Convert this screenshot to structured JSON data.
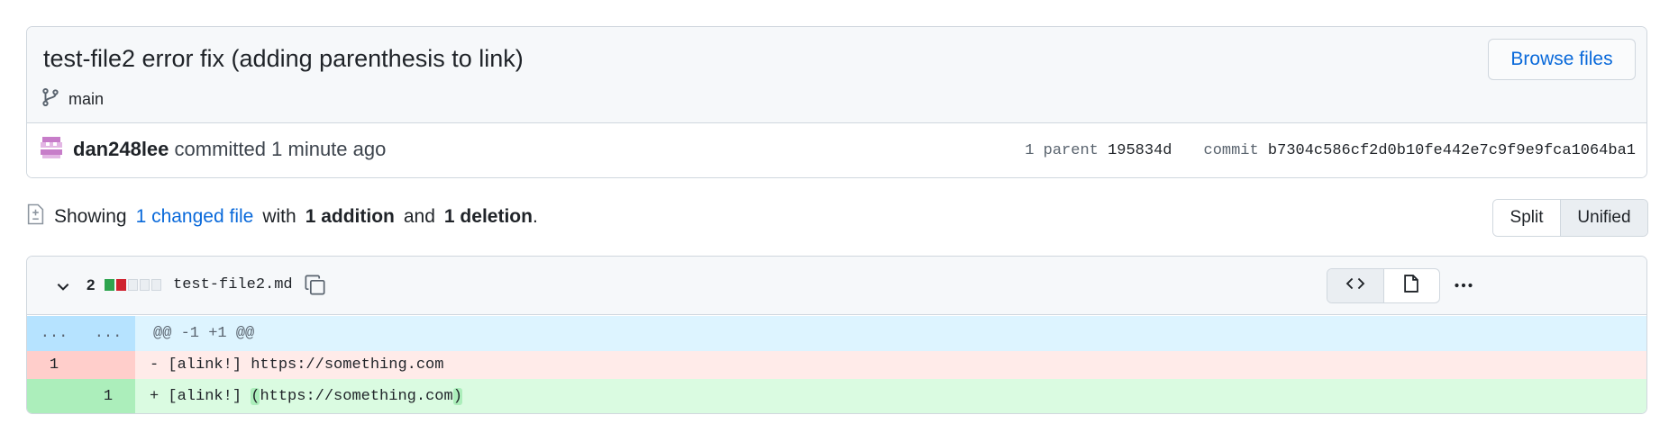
{
  "commit": {
    "title": "test-file2 error fix (adding parenthesis to link)",
    "branch": "main",
    "browse_button": "Browse files",
    "author": "dan248lee",
    "action": "committed",
    "time": "1 minute ago",
    "parent_label": "1 parent",
    "parent_sha": "195834d",
    "commit_label": "commit",
    "commit_sha": "b7304c586cf2d0b10fe442e7c9f9e9fca1064ba1"
  },
  "summary": {
    "showing": "Showing",
    "changed_files": "1 changed file",
    "with": "with",
    "additions": "1 addition",
    "and": "and",
    "deletions": "1 deletion",
    "period": "."
  },
  "view_toggle": {
    "split": "Split",
    "unified": "Unified",
    "selected": "Unified"
  },
  "file": {
    "change_count": "2",
    "diffstat": [
      "added",
      "deleted",
      "neutral",
      "neutral",
      "neutral"
    ],
    "name": "test-file2.md",
    "hunk": {
      "old_marker": "...",
      "new_marker": "...",
      "header": "@@ -1 +1 @@"
    },
    "deleted_line": {
      "old_num": "1",
      "new_num": "",
      "prefix": "-",
      "text": "[alink!] https://something.com"
    },
    "added_line": {
      "old_num": "",
      "new_num": "1",
      "prefix": "+",
      "text_before": "[alink!] ",
      "text_open": "(",
      "text_mid": "https://something.com",
      "text_close": ")"
    }
  },
  "icons": {
    "branch": "git-branch-icon",
    "file_diff": "file-diff-icon",
    "chevron": "chevron-down-icon",
    "copy": "copy-icon",
    "code": "code-icon",
    "file": "file-icon",
    "kebab": "kebab-horizontal-icon"
  },
  "colors": {
    "link": "#0969da",
    "added": "#2da44e",
    "deleted": "#cf222e",
    "hunk_bg": "#ddf4ff",
    "del_bg": "#ffebe9",
    "add_bg": "#dafbe1"
  }
}
